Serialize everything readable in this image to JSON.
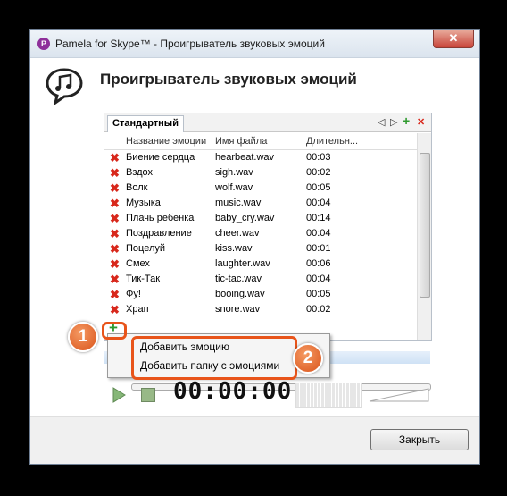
{
  "window": {
    "app_icon_letter": "P",
    "title": "Pamela for Skype™ - Проигрыватель звуковых эмоций",
    "close_glyph": "✕"
  },
  "header": {
    "title": "Проигрыватель звуковых эмоций",
    "icon": "music-note-speech-bubble-icon"
  },
  "panel": {
    "tab_label": "Стандартный",
    "tab_controls": {
      "prev": "◁",
      "next": "▷",
      "add": "+",
      "remove": "✕"
    },
    "columns": [
      "Название эмоции",
      "Имя файла",
      "Длительн..."
    ],
    "rows": [
      {
        "name": "Биение сердца",
        "file": "hearbeat.wav",
        "duration": "00:03"
      },
      {
        "name": "Вздох",
        "file": "sigh.wav",
        "duration": "00:02"
      },
      {
        "name": "Волк",
        "file": "wolf.wav",
        "duration": "00:05"
      },
      {
        "name": "Музыка",
        "file": "music.wav",
        "duration": "00:04"
      },
      {
        "name": "Плачь ребенка",
        "file": "baby_cry.wav",
        "duration": "00:14"
      },
      {
        "name": "Поздравление",
        "file": "cheer.wav",
        "duration": "00:04"
      },
      {
        "name": "Поцелуй",
        "file": "kiss.wav",
        "duration": "00:01"
      },
      {
        "name": "Смех",
        "file": "laughter.wav",
        "duration": "00:06"
      },
      {
        "name": "Тик-Так",
        "file": "tic-tac.wav",
        "duration": "00:04"
      },
      {
        "name": "Фу!",
        "file": "booing.wav",
        "duration": "00:05"
      },
      {
        "name": "Храп",
        "file": "snore.wav",
        "duration": "00:02"
      }
    ],
    "add_glyph": "+"
  },
  "context_menu": {
    "items": [
      "Добавить эмоцию",
      "Добавить папку с эмоциями"
    ]
  },
  "callouts": {
    "one": "1",
    "two": "2"
  },
  "player": {
    "time": "00:00:00"
  },
  "footer": {
    "close_label": "Закрыть"
  },
  "colors": {
    "accent_callout": "#e8541a",
    "delete_red": "#d8281c",
    "add_green": "#2f9a2f"
  }
}
